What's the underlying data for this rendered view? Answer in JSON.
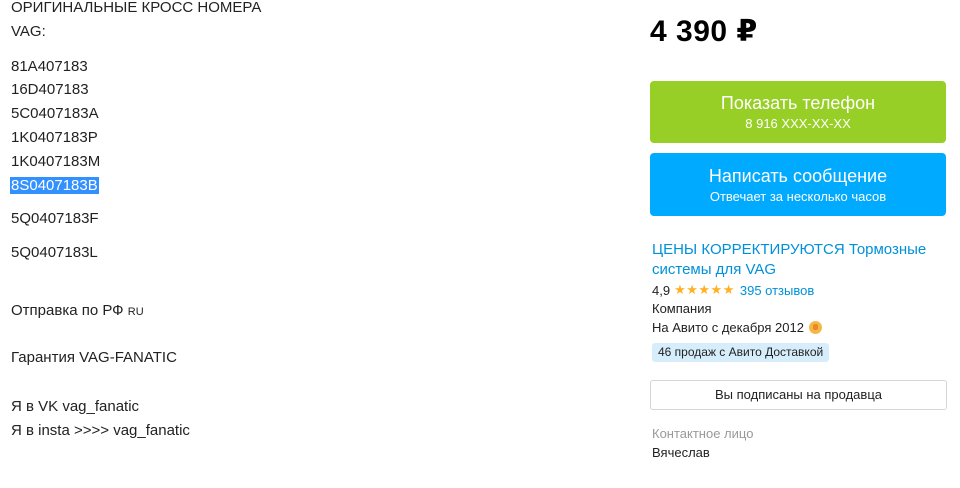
{
  "description": {
    "heading": "ОРИГИНАЛЬНЫЕ КРОСС НОМЕРА",
    "brand": "VAG:",
    "numbers": [
      "81A407183",
      "16D407183",
      "5C0407183A",
      "1K0407183P",
      "1K0407183M"
    ],
    "selected_number": "8S0407183B",
    "numbers_after": [
      "5Q0407183F",
      "5Q0407183L"
    ],
    "shipping": "Отправка по РФ",
    "shipping_tag": "RU",
    "warranty": "Гарантия VAG-FANATIC",
    "vk": "Я в VK vag_fanatic",
    "insta": "Я в insta >>>> vag_fanatic"
  },
  "price": "4 390 ₽",
  "phone_button": {
    "label": "Показать телефон",
    "sub": "8 916 XXX-XX-XX",
    "color": "#97cf26"
  },
  "message_button": {
    "label": "Написать сообщение",
    "sub": "Отвечает за несколько часов",
    "color": "#00aaff"
  },
  "seller": {
    "name": "ЦЕНЫ КОРРЕКТИРУЮТСЯ Тормозные системы для VAG",
    "rating": "4,9",
    "stars": "★★★★★",
    "reviews": "395 отзывов",
    "type": "Компания",
    "since": "На Авито с декабря 2012",
    "delivery_badge": "46 продаж с Авито Доставкой",
    "subscribe_label": "Вы подписаны на продавца"
  },
  "contact": {
    "label": "Контактное лицо",
    "name": "Вячеслав"
  }
}
